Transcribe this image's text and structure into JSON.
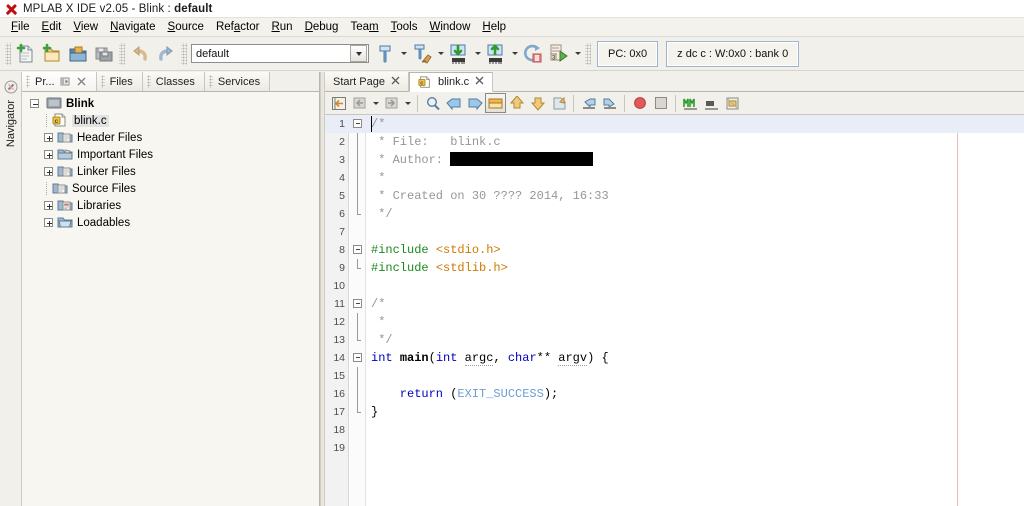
{
  "window": {
    "title_prefix": "MPLAB X IDE v2.05 - Blink : ",
    "title_project": "default",
    "app_icon": "red-x-icon"
  },
  "menubar": {
    "items": [
      {
        "label": "File",
        "mnemonic": "F"
      },
      {
        "label": "Edit",
        "mnemonic": "E"
      },
      {
        "label": "View",
        "mnemonic": "V"
      },
      {
        "label": "Navigate",
        "mnemonic": "N"
      },
      {
        "label": "Source",
        "mnemonic": "S"
      },
      {
        "label": "Refactor",
        "mnemonic": "a"
      },
      {
        "label": "Run",
        "mnemonic": "R"
      },
      {
        "label": "Debug",
        "mnemonic": "D"
      },
      {
        "label": "Team",
        "mnemonic": "m"
      },
      {
        "label": "Tools",
        "mnemonic": "T"
      },
      {
        "label": "Window",
        "mnemonic": "W"
      },
      {
        "label": "Help",
        "mnemonic": "H"
      }
    ]
  },
  "toolbar": {
    "buttons": [
      {
        "name": "new-file-button",
        "tip": "New File"
      },
      {
        "name": "new-project-button",
        "tip": "New Project"
      },
      {
        "name": "open-project-button",
        "tip": "Open Project"
      },
      {
        "name": "save-all-button",
        "tip": "Save All"
      },
      {
        "name": "undo-button",
        "tip": "Undo"
      },
      {
        "name": "redo-button",
        "tip": "Redo"
      }
    ],
    "configuration": {
      "value": "default",
      "placeholder": "default"
    },
    "build_buttons": [
      {
        "name": "build-project-button",
        "tip": "Build Project"
      },
      {
        "name": "clean-build-button",
        "tip": "Clean and Build Project"
      },
      {
        "name": "make-program-button",
        "tip": "Make and Program Device"
      },
      {
        "name": "program-button",
        "tip": "Program Device"
      },
      {
        "name": "hold-reset-button",
        "tip": "Hold in Reset"
      },
      {
        "name": "debug-project-button",
        "tip": "Debug Project"
      }
    ],
    "status": {
      "pc_label": "PC: 0x0",
      "registers_label": "z dc c  : W:0x0 : bank 0"
    }
  },
  "navigator": {
    "label": "Navigator",
    "icon": "navigator-icon"
  },
  "left_pane": {
    "tabs": [
      {
        "label": "Pr...",
        "name": "tab-projects",
        "active": true
      },
      {
        "label": "Files",
        "name": "tab-files",
        "active": false
      },
      {
        "label": "Classes",
        "name": "tab-classes",
        "active": false
      },
      {
        "label": "Services",
        "name": "tab-services",
        "active": false
      }
    ],
    "tab_buttons": [
      {
        "name": "minimize-window-group-icon"
      },
      {
        "name": "close-window-icon"
      }
    ],
    "tree": [
      {
        "label": "Blink",
        "level": 0,
        "icon": "project-icon",
        "expander": "minus",
        "bold": true,
        "selected": false
      },
      {
        "label": "blink.c",
        "level": 1,
        "icon": "c-file-icon",
        "expander": "none",
        "bold": false,
        "selected": true
      },
      {
        "label": "Header Files",
        "level": 1,
        "icon": "folder-icon",
        "expander": "plus",
        "bold": false,
        "selected": false
      },
      {
        "label": "Important Files",
        "level": 1,
        "icon": "important-folder-icon",
        "expander": "plus",
        "bold": false,
        "selected": false
      },
      {
        "label": "Linker Files",
        "level": 1,
        "icon": "linker-folder-icon",
        "expander": "plus",
        "bold": false,
        "selected": false
      },
      {
        "label": "Source Files",
        "level": 1,
        "icon": "source-folder-icon",
        "expander": "none",
        "bold": false,
        "selected": false
      },
      {
        "label": "Libraries",
        "level": 1,
        "icon": "libraries-folder-icon",
        "expander": "plus",
        "bold": false,
        "selected": false
      },
      {
        "label": "Loadables",
        "level": 1,
        "icon": "loadables-folder-icon",
        "expander": "plus",
        "bold": false,
        "selected": false
      }
    ]
  },
  "editor": {
    "tabs": [
      {
        "label": "Start Page",
        "name": "tab-start-page",
        "active": false,
        "closable": true,
        "icon": "none"
      },
      {
        "label": "blink.c",
        "name": "tab-blink-c",
        "active": true,
        "closable": true,
        "icon": "c-file-icon"
      }
    ],
    "toolbar_buttons": [
      {
        "name": "last-edit-position-icon"
      },
      {
        "name": "back-icon"
      },
      {
        "name": "forward-icon"
      },
      {
        "name": "find-selection-icon"
      },
      {
        "name": "find-previous-icon"
      },
      {
        "name": "find-next-icon"
      },
      {
        "name": "toggle-highlight-icon"
      },
      {
        "name": "previous-bookmark-icon"
      },
      {
        "name": "next-bookmark-icon"
      },
      {
        "name": "toggle-bookmark-icon"
      },
      {
        "name": "shift-left-icon"
      },
      {
        "name": "shift-right-icon"
      },
      {
        "name": "toggle-breakpoint-icon"
      },
      {
        "name": "stop-icon"
      },
      {
        "name": "start-macro-icon"
      },
      {
        "name": "stop-macro-icon"
      },
      {
        "name": "toggle-rectangular-selection-icon"
      }
    ],
    "lines": [
      {
        "n": "1",
        "fold": "start",
        "cur": true,
        "segments": [
          {
            "t": "/*",
            "c": "c-com"
          }
        ]
      },
      {
        "n": "2",
        "fold": "bar",
        "cur": false,
        "segments": [
          {
            "t": " * File:   blink.c",
            "c": "c-com"
          }
        ]
      },
      {
        "n": "3",
        "fold": "bar",
        "cur": false,
        "segments": [
          {
            "t": " * Author: ",
            "c": "c-com"
          },
          {
            "t": "",
            "c": "redact",
            "w": 143
          }
        ]
      },
      {
        "n": "4",
        "fold": "bar",
        "cur": false,
        "segments": [
          {
            "t": " *",
            "c": "c-com"
          }
        ]
      },
      {
        "n": "5",
        "fold": "bar",
        "cur": false,
        "segments": [
          {
            "t": " * Created on 30 ???? 2014, 16:33",
            "c": "c-com"
          }
        ]
      },
      {
        "n": "6",
        "fold": "end",
        "cur": false,
        "segments": [
          {
            "t": " */",
            "c": "c-com"
          }
        ]
      },
      {
        "n": "7",
        "fold": "none",
        "cur": false,
        "segments": []
      },
      {
        "n": "8",
        "fold": "start",
        "cur": false,
        "segments": [
          {
            "t": "#include ",
            "c": "c-pp"
          },
          {
            "t": "<stdio.h>",
            "c": "c-str"
          }
        ]
      },
      {
        "n": "9",
        "fold": "end",
        "cur": false,
        "segments": [
          {
            "t": "#include ",
            "c": "c-pp"
          },
          {
            "t": "<stdlib.h>",
            "c": "c-str"
          }
        ]
      },
      {
        "n": "10",
        "fold": "none",
        "cur": false,
        "segments": []
      },
      {
        "n": "11",
        "fold": "start",
        "cur": false,
        "segments": [
          {
            "t": "/*",
            "c": "c-com"
          }
        ]
      },
      {
        "n": "12",
        "fold": "bar",
        "cur": false,
        "segments": [
          {
            "t": " *",
            "c": "c-com"
          }
        ]
      },
      {
        "n": "13",
        "fold": "end",
        "cur": false,
        "segments": [
          {
            "t": " */",
            "c": "c-com"
          }
        ]
      },
      {
        "n": "14",
        "fold": "start",
        "cur": false,
        "segments": [
          {
            "t": "int ",
            "c": "c-kw"
          },
          {
            "t": "main",
            "c": "c-bold"
          },
          {
            "t": "(",
            "c": "c-id"
          },
          {
            "t": "int ",
            "c": "c-kw"
          },
          {
            "t": "argc",
            "c": "c-und"
          },
          {
            "t": ", ",
            "c": "c-id"
          },
          {
            "t": "char",
            "c": "c-kw"
          },
          {
            "t": "** ",
            "c": "c-id"
          },
          {
            "t": "argv",
            "c": "c-und"
          },
          {
            "t": ") {",
            "c": "c-id"
          }
        ]
      },
      {
        "n": "15",
        "fold": "bar",
        "cur": false,
        "segments": []
      },
      {
        "n": "16",
        "fold": "bar",
        "cur": false,
        "segments": [
          {
            "t": "    return ",
            "c": "c-kw"
          },
          {
            "t": "(",
            "c": "c-id"
          },
          {
            "t": "EXIT_SUCCESS",
            "c": "c-cst"
          },
          {
            "t": ");",
            "c": "c-id"
          }
        ]
      },
      {
        "n": "17",
        "fold": "end",
        "cur": false,
        "segments": [
          {
            "t": "}",
            "c": "c-id"
          }
        ]
      },
      {
        "n": "18",
        "fold": "none",
        "cur": false,
        "segments": []
      },
      {
        "n": "19",
        "fold": "none",
        "cur": false,
        "segments": []
      }
    ]
  },
  "colors": {
    "comment": "#969696",
    "keyword": "#0000c0",
    "preprocessor": "#1d8a1d",
    "string": "#ce7b00",
    "constant": "#6c9fd4",
    "current_line": "#e8edf7",
    "margin_line": "#f0b9b9",
    "status_border": "#9db4cc",
    "title_icon": "#c00d0d"
  }
}
